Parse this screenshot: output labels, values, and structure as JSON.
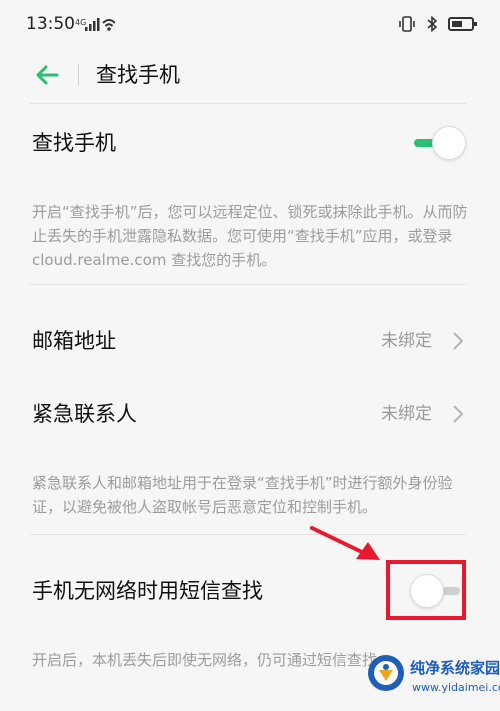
{
  "status_bar": {
    "time": "13:50",
    "network": "4G"
  },
  "header": {
    "title": "查找手机"
  },
  "find_phone": {
    "label": "查找手机",
    "enabled": true,
    "description": "开启“查找手机”后，您可以远程定位、锁死或抹除此手机。从而防止丢失的手机泄露隐私数据。您可使用“查找手机”应用，或登录 cloud.realme.com 查找您的手机。"
  },
  "email": {
    "label": "邮箱地址",
    "value": "未绑定"
  },
  "emergency_contact": {
    "label": "紧急联系人",
    "value": "未绑定"
  },
  "verification_note": "紧急联系人和邮箱地址用于在登录“查找手机”时进行额外身份验证，以避免被他人盗取帐号后恶意定位和控制手机。",
  "sms_find": {
    "label": "手机无网络时用短信查找",
    "enabled": false,
    "description": "开启后，本机丢失后即使无网络，仍可通过短信查找。"
  },
  "watermark": {
    "title": "纯净系统家园",
    "url": "www.yidaimei.com"
  },
  "colors": {
    "accent": "#2bbf75",
    "annotation": "#e8192c",
    "watermark": "#1f5fb8"
  },
  "icons": {
    "back": "arrow-left-icon",
    "chevron": "chevron-right-icon"
  }
}
